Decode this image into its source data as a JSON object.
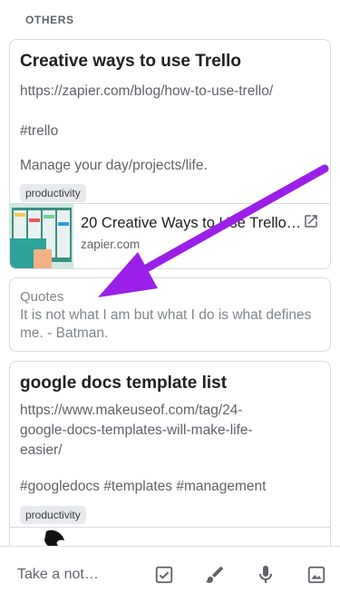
{
  "section": {
    "label": "OTHERS"
  },
  "notes": [
    {
      "title": "Creative ways to use Trello",
      "lines": [
        "https://zapier.com/blog/how-to-use-trello/",
        "",
        "#trello",
        "",
        "Manage your day/projects/life."
      ],
      "label": "productivity",
      "link": {
        "title": "20 Creative Ways to Use Trello…",
        "domain": "zapier.com"
      }
    },
    {
      "title": "Quotes",
      "body": "It is not what I am but what I do is what defines me. - Batman."
    },
    {
      "title": "google docs template list",
      "lines": [
        "https://www.makeuseof.com/tag/24-",
        "google-docs-templates-will-make-life-",
        "easier/",
        "",
        "#googledocs #templates #management"
      ],
      "label": "productivity"
    }
  ],
  "bottom_bar": {
    "placeholder": "Take a not…",
    "icons": [
      "checkbox-icon",
      "brush-icon",
      "microphone-icon",
      "image-icon"
    ]
  },
  "colors": {
    "annotation_arrow": "#9b1fe8",
    "chip_bg": "#e8eaed"
  }
}
